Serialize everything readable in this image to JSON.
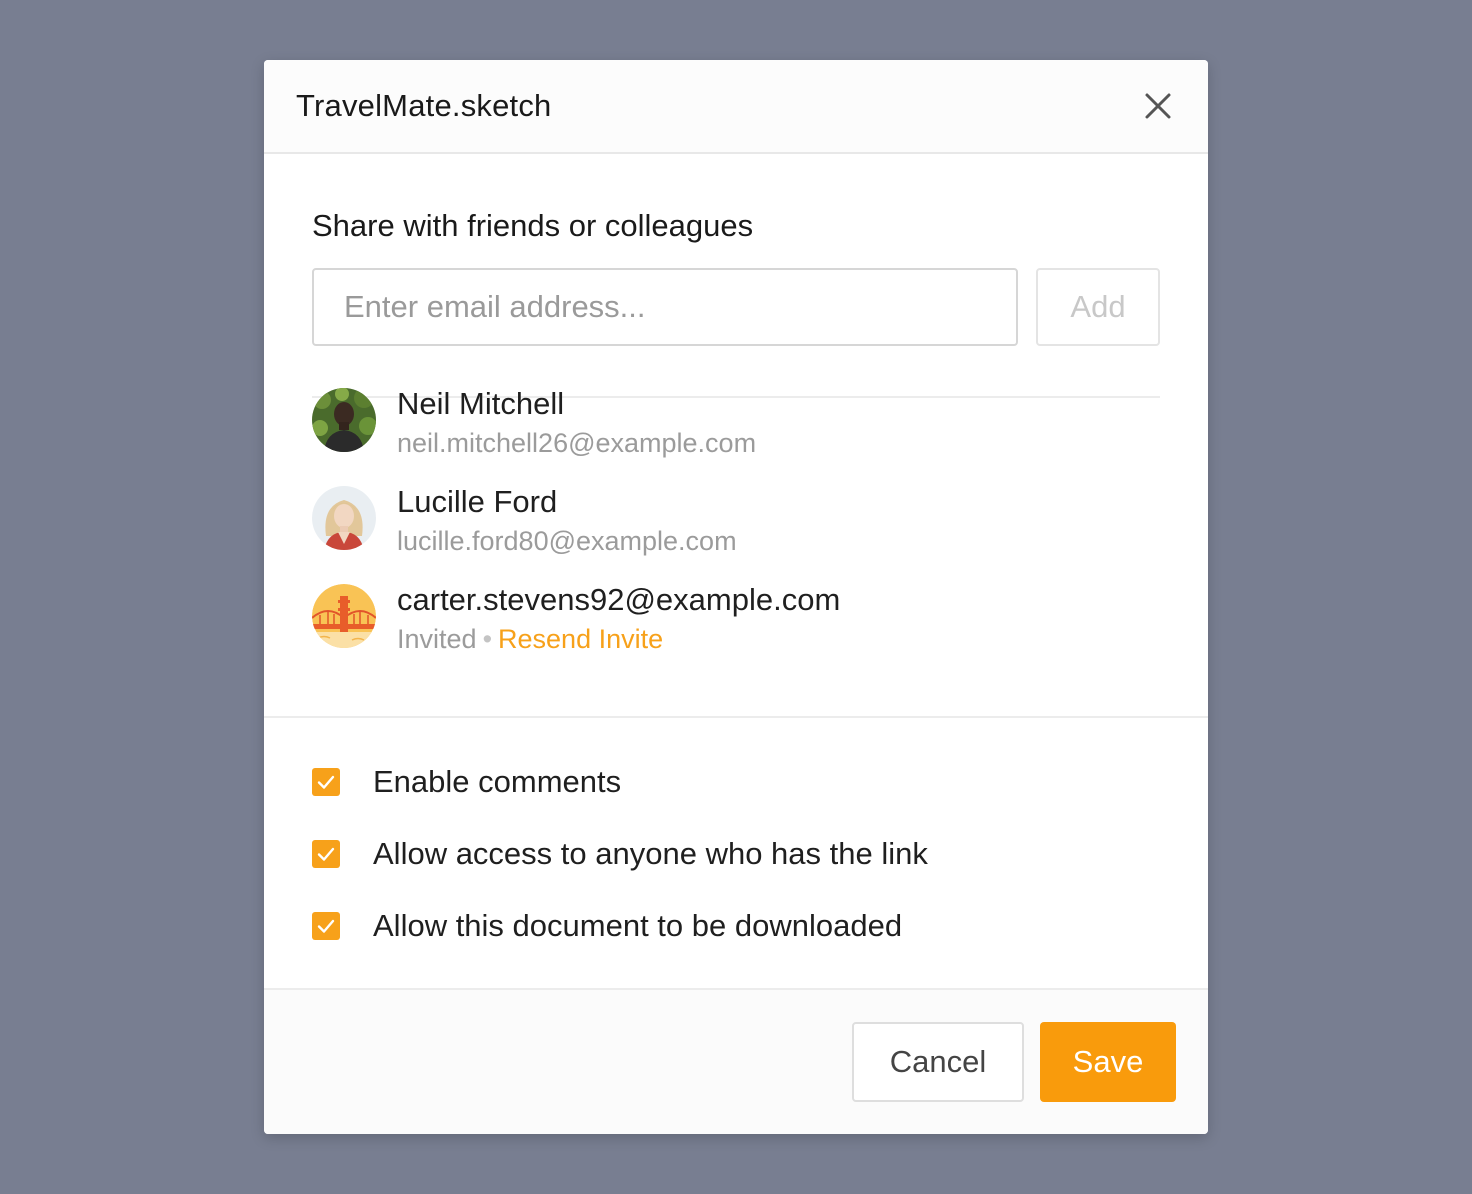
{
  "dialog": {
    "title": "TravelMate.sketch",
    "close_icon": "close-icon"
  },
  "share": {
    "heading": "Share with friends or colleagues",
    "email_placeholder": "Enter email address...",
    "email_value": "",
    "add_label": "Add"
  },
  "people": [
    {
      "name": "Neil Mitchell",
      "email": "neil.mitchell26@example.com",
      "avatar": "user-avatar-photo"
    },
    {
      "name": "Lucille Ford",
      "email": "lucille.ford80@example.com",
      "avatar": "user-avatar-photo"
    },
    {
      "name": "carter.stevens92@example.com",
      "status": "Invited",
      "separator": "•",
      "resend_label": "Resend Invite",
      "avatar": "golden-gate-bridge-avatar"
    }
  ],
  "options": [
    {
      "label": "Enable comments",
      "checked": true
    },
    {
      "label": "Allow access to anyone who has the link",
      "checked": true
    },
    {
      "label": "Allow this document to be downloaded",
      "checked": true
    }
  ],
  "footer": {
    "cancel_label": "Cancel",
    "save_label": "Save"
  },
  "colors": {
    "backdrop": "#787e91",
    "accent": "#f99b0c",
    "link": "#f7a11a",
    "muted_text": "#9b9b9b"
  }
}
